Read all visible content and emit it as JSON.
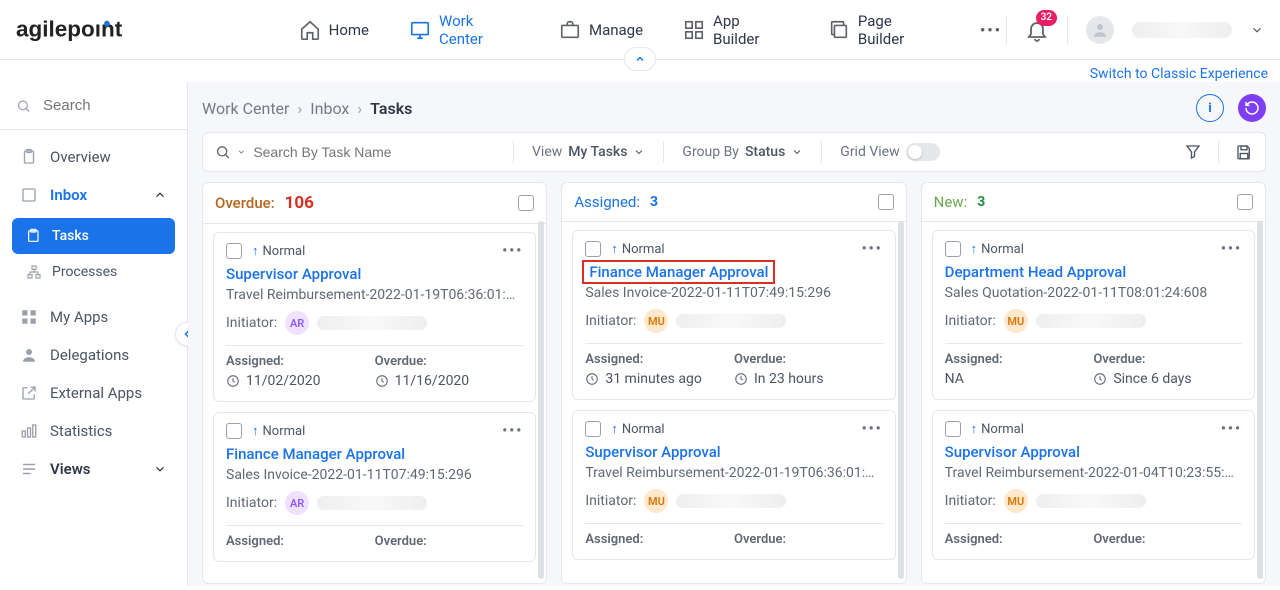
{
  "brand": "agilepoint",
  "topnav": {
    "home": "Home",
    "work_center": "Work Center",
    "manage": "Manage",
    "app_builder": "App Builder",
    "page_builder": "Page Builder"
  },
  "notifications": {
    "count": "32"
  },
  "switch_link": "Switch to Classic Experience",
  "sidebar": {
    "search_placeholder": "Search",
    "items": {
      "overview": "Overview",
      "inbox": "Inbox",
      "tasks": "Tasks",
      "processes": "Processes",
      "my_apps": "My Apps",
      "delegations": "Delegations",
      "external_apps": "External Apps",
      "statistics": "Statistics",
      "views": "Views"
    }
  },
  "breadcrumb": {
    "root": "Work Center",
    "mid": "Inbox",
    "leaf": "Tasks"
  },
  "filterbar": {
    "search_placeholder": "Search By Task Name",
    "view_lbl": "View",
    "view_val": "My Tasks",
    "group_lbl": "Group By",
    "group_val": "Status",
    "grid_lbl": "Grid View"
  },
  "columns": {
    "overdue": {
      "title": "Overdue:",
      "count": "106"
    },
    "assigned": {
      "title": "Assigned:",
      "count": "3"
    },
    "new": {
      "title": "New:",
      "count": "3"
    }
  },
  "priority_label": "Normal",
  "labels": {
    "initiator": "Initiator:",
    "assigned": "Assigned:",
    "overdue": "Overdue:"
  },
  "cards": {
    "c1": {
      "title": "Supervisor Approval",
      "sub": "Travel Reimbursement-2022-01-19T06:36:01:…",
      "chip": "AR",
      "assigned": "11/02/2020",
      "overdue": "11/16/2020"
    },
    "c2": {
      "title": "Finance Manager Approval",
      "sub": "Sales Invoice-2022-01-11T07:49:15:296",
      "chip": "AR",
      "assigned": "",
      "overdue": ""
    },
    "c3": {
      "title": "Finance Manager Approval",
      "sub": "Sales Invoice-2022-01-11T07:49:15:296",
      "chip": "MU",
      "assigned": "31 minutes ago",
      "overdue": "In 23 hours"
    },
    "c4": {
      "title": "Supervisor Approval",
      "sub": "Travel Reimbursement-2022-01-19T06:36:01:…",
      "chip": "MU",
      "assigned": "",
      "overdue": ""
    },
    "c5": {
      "title": "Department Head Approval",
      "sub": "Sales Quotation-2022-01-11T08:01:24:608",
      "chip": "MU",
      "assigned": "NA",
      "overdue": "Since 6 days"
    },
    "c6": {
      "title": "Supervisor Approval",
      "sub": "Travel Reimbursement-2022-01-04T10:23:55:…",
      "chip": "MU",
      "assigned": "",
      "overdue": ""
    }
  }
}
